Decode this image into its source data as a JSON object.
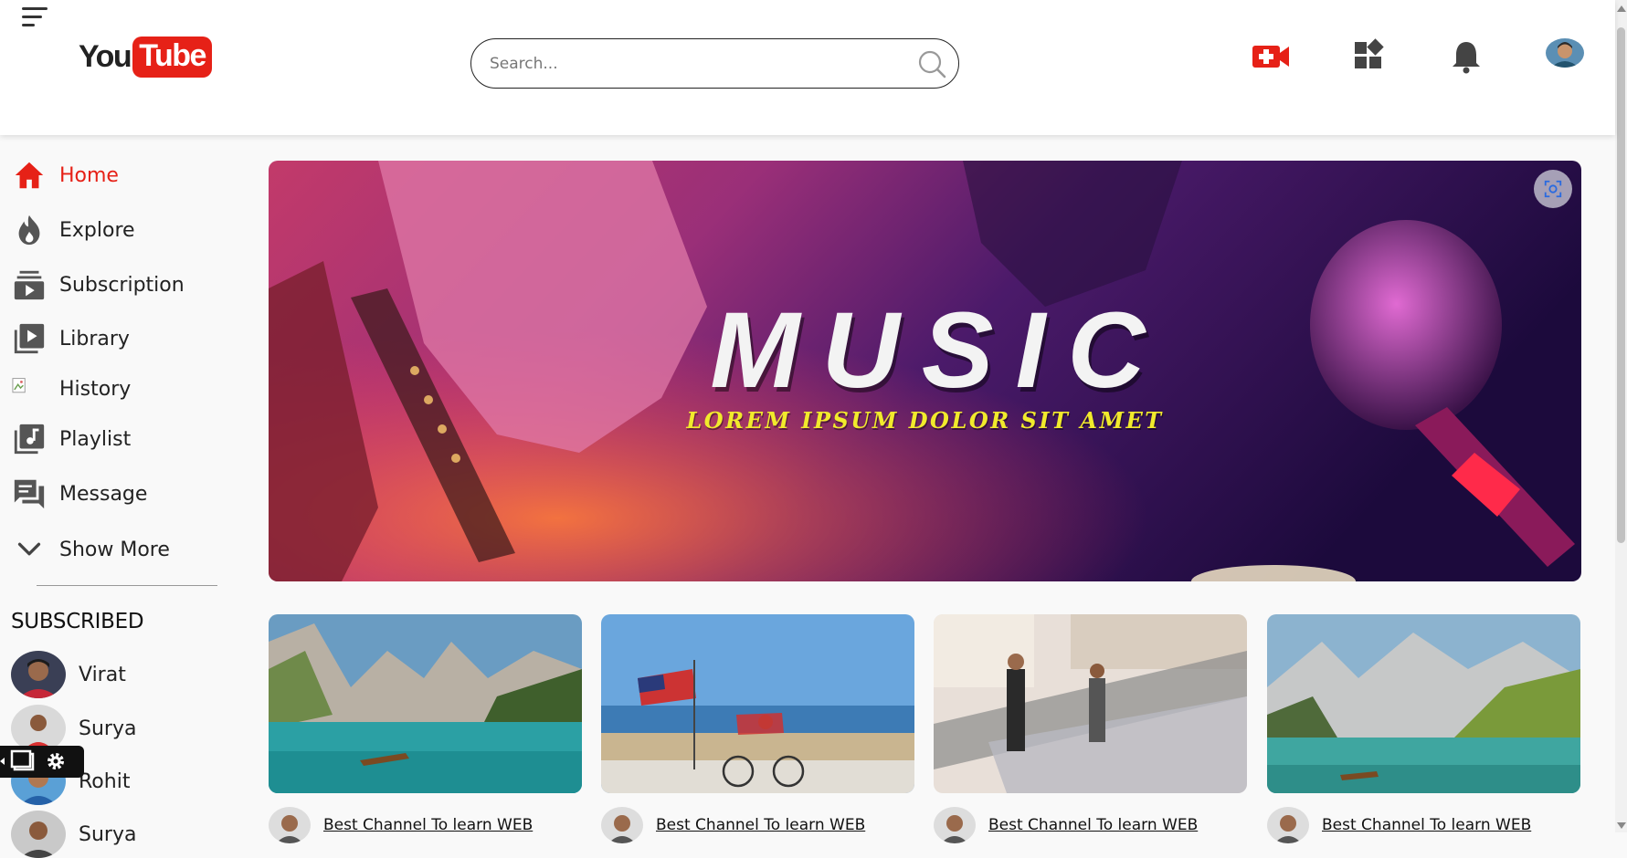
{
  "header": {
    "logo_you": "You",
    "logo_tube": "Tube",
    "search_placeholder": "Search...",
    "icons": [
      "menu-icon",
      "create-video-icon",
      "apps-icon",
      "notifications-icon",
      "user-avatar"
    ]
  },
  "sidebar": {
    "items": [
      {
        "label": "Home",
        "icon": "home-icon",
        "active": true
      },
      {
        "label": "Explore",
        "icon": "explore-icon"
      },
      {
        "label": "Subscription",
        "icon": "subscription-icon"
      },
      {
        "label": "Library",
        "icon": "library-icon"
      },
      {
        "label": "History",
        "icon": "history-icon"
      },
      {
        "label": "Playlist",
        "icon": "playlist-icon"
      },
      {
        "label": "Message",
        "icon": "message-icon"
      },
      {
        "label": "Show More",
        "icon": "chevron-down-icon"
      }
    ],
    "subscribed_title": "SUBSCRIBED",
    "subscriptions": [
      {
        "name": "Virat"
      },
      {
        "name": "Surya"
      },
      {
        "name": "Rohit"
      },
      {
        "name": "Surya"
      }
    ]
  },
  "banner": {
    "title": "MUSIC",
    "subtitle": "LOREM IPSUM DOLOR SIT AMET"
  },
  "videos": [
    {
      "title": "Best Channel To learn WEB"
    },
    {
      "title": "Best Channel To learn WEB"
    },
    {
      "title": "Best Channel To learn WEB"
    },
    {
      "title": "Best Channel To learn WEB"
    }
  ],
  "colors": {
    "accent": "#e62117",
    "text": "#222222"
  }
}
